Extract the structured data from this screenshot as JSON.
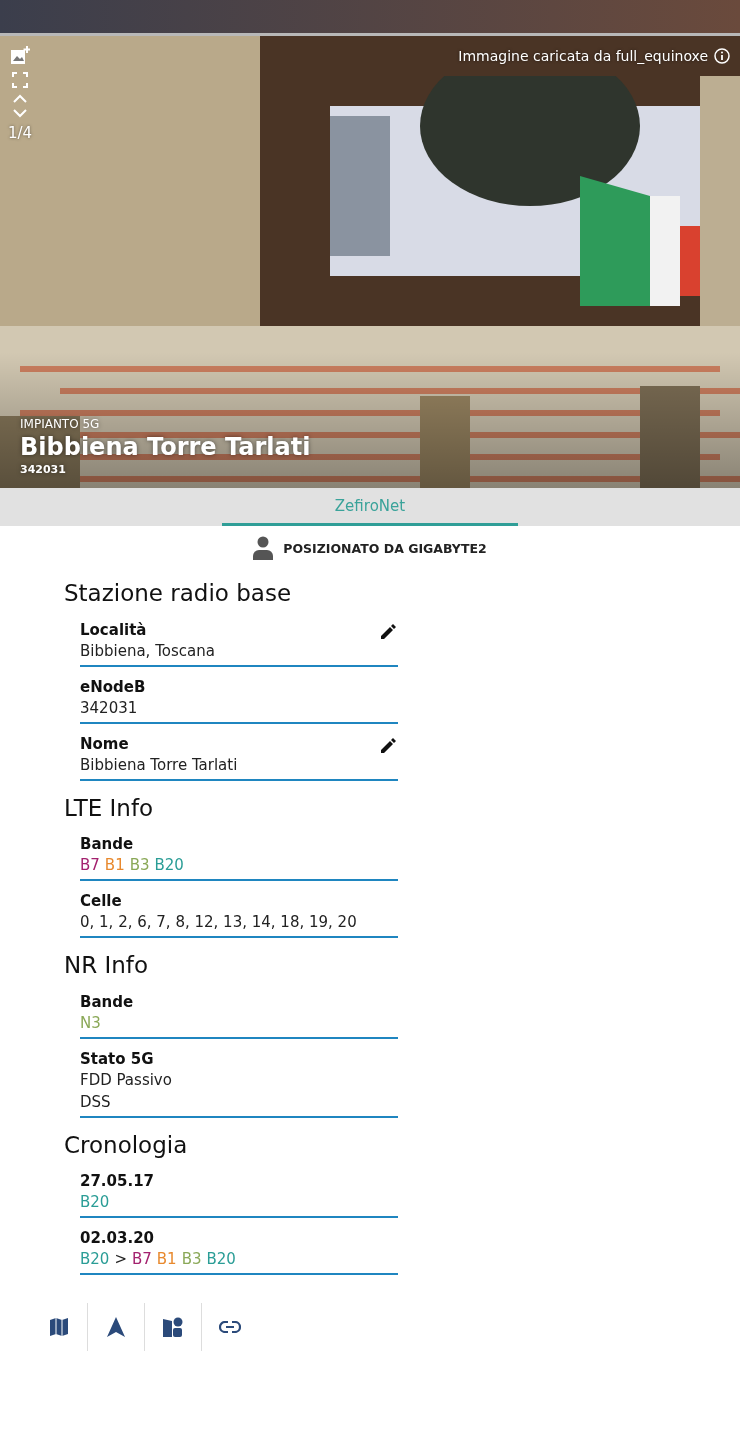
{
  "photo": {
    "kind": "picture",
    "counter": "1/4",
    "credit": "Immagine caricata da full_equinoxe",
    "overline": "IMPIANTO 5G",
    "title": "Bibbiena Torre Tarlati",
    "subtitle": "342031"
  },
  "tabs": [
    {
      "label": "ZefiroNet",
      "selected": true
    }
  ],
  "placed_by": "POSIZIONATO DA GIGABYTE2",
  "sections": [
    {
      "title": "Stazione radio base",
      "fields": [
        {
          "label": "Località",
          "editable": true,
          "lines": [
            [
              {
                "kind": "text",
                "text": "Bibbiena, Toscana"
              }
            ]
          ]
        },
        {
          "label": "eNodeB",
          "editable": false,
          "lines": [
            [
              {
                "kind": "text",
                "text": "342031"
              }
            ]
          ]
        },
        {
          "label": "Nome",
          "editable": true,
          "lines": [
            [
              {
                "kind": "text",
                "text": "Bibbiena Torre Tarlati"
              }
            ]
          ]
        }
      ]
    },
    {
      "title": "LTE Info",
      "fields": [
        {
          "label": "Bande",
          "editable": false,
          "lines": [
            [
              {
                "kind": "band",
                "text": "B7",
                "color": "#a3216e"
              },
              {
                "kind": "band",
                "text": "B1",
                "color": "#e8892e"
              },
              {
                "kind": "band",
                "text": "B3",
                "color": "#8aa857"
              },
              {
                "kind": "band",
                "text": "B20",
                "color": "#2a9d96"
              }
            ]
          ]
        },
        {
          "label": "Celle",
          "editable": false,
          "lines": [
            [
              {
                "kind": "text",
                "text": "0, 1, 2, 6, 7, 8, 12, 13, 14, 18, 19, 20"
              }
            ]
          ]
        }
      ]
    },
    {
      "title": "NR Info",
      "fields": [
        {
          "label": "Bande",
          "editable": false,
          "lines": [
            [
              {
                "kind": "band",
                "text": "N3",
                "color": "#8aa857"
              }
            ]
          ]
        },
        {
          "label": "Stato 5G",
          "editable": false,
          "lines": [
            [
              {
                "kind": "text",
                "text": "FDD Passivo"
              }
            ],
            [
              {
                "kind": "text",
                "text": "DSS"
              }
            ]
          ]
        }
      ]
    },
    {
      "title": "Cronologia",
      "fields": [
        {
          "label": "27.05.17",
          "editable": false,
          "lines": [
            [
              {
                "kind": "band",
                "text": "B20",
                "color": "#2a9d96"
              }
            ]
          ]
        },
        {
          "label": "02.03.20",
          "editable": false,
          "lines": [
            [
              {
                "kind": "band",
                "text": "B20",
                "color": "#2a9d96"
              },
              {
                "kind": "text",
                "text": ">"
              },
              {
                "kind": "band",
                "text": "B7",
                "color": "#a3216e"
              },
              {
                "kind": "band",
                "text": "B1",
                "color": "#e8892e"
              },
              {
                "kind": "band",
                "text": "B3",
                "color": "#8aa857"
              },
              {
                "kind": "band",
                "text": "B20",
                "color": "#2a9d96"
              }
            ]
          ]
        }
      ]
    }
  ],
  "toolbar": [
    {
      "kind": "map"
    },
    {
      "kind": "navigate"
    },
    {
      "kind": "shapes"
    },
    {
      "kind": "link"
    }
  ]
}
